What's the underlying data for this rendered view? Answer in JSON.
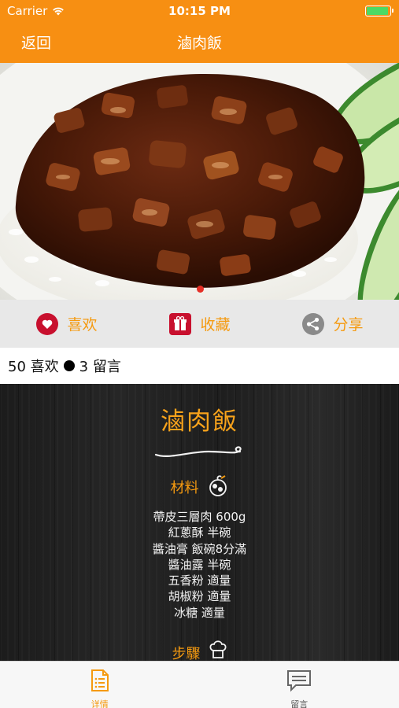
{
  "status_bar": {
    "carrier": "Carrier",
    "time": "10:15 PM"
  },
  "nav": {
    "back_label": "返回",
    "title": "滷肉飯"
  },
  "actions": [
    {
      "label": "喜欢",
      "icon": "heart-icon",
      "color": "#c8102e"
    },
    {
      "label": "收藏",
      "icon": "gift-icon",
      "color": "#c8102e"
    },
    {
      "label": "分享",
      "icon": "share-icon",
      "color": "#8a8a8a"
    }
  ],
  "stats": {
    "likes": "50 喜欢",
    "comments": "3 留言"
  },
  "recipe": {
    "title": "滷肉飯",
    "ingredients_heading": "材料",
    "ingredients": [
      "帶皮三層肉 600g",
      "紅蔥酥 半碗",
      "醬油膏 飯碗8分滿",
      "醬油露 半碗",
      "五香粉 適量",
      "胡椒粉 適量",
      "冰糖 適量"
    ],
    "steps_heading": "步驟"
  },
  "tabs": [
    {
      "label": "详情",
      "icon": "document-icon",
      "active": true
    },
    {
      "label": "留言",
      "icon": "chat-icon",
      "active": false
    }
  ],
  "colors": {
    "accent": "#f78f12",
    "label_orange": "#f59a10",
    "board": "#222222"
  }
}
